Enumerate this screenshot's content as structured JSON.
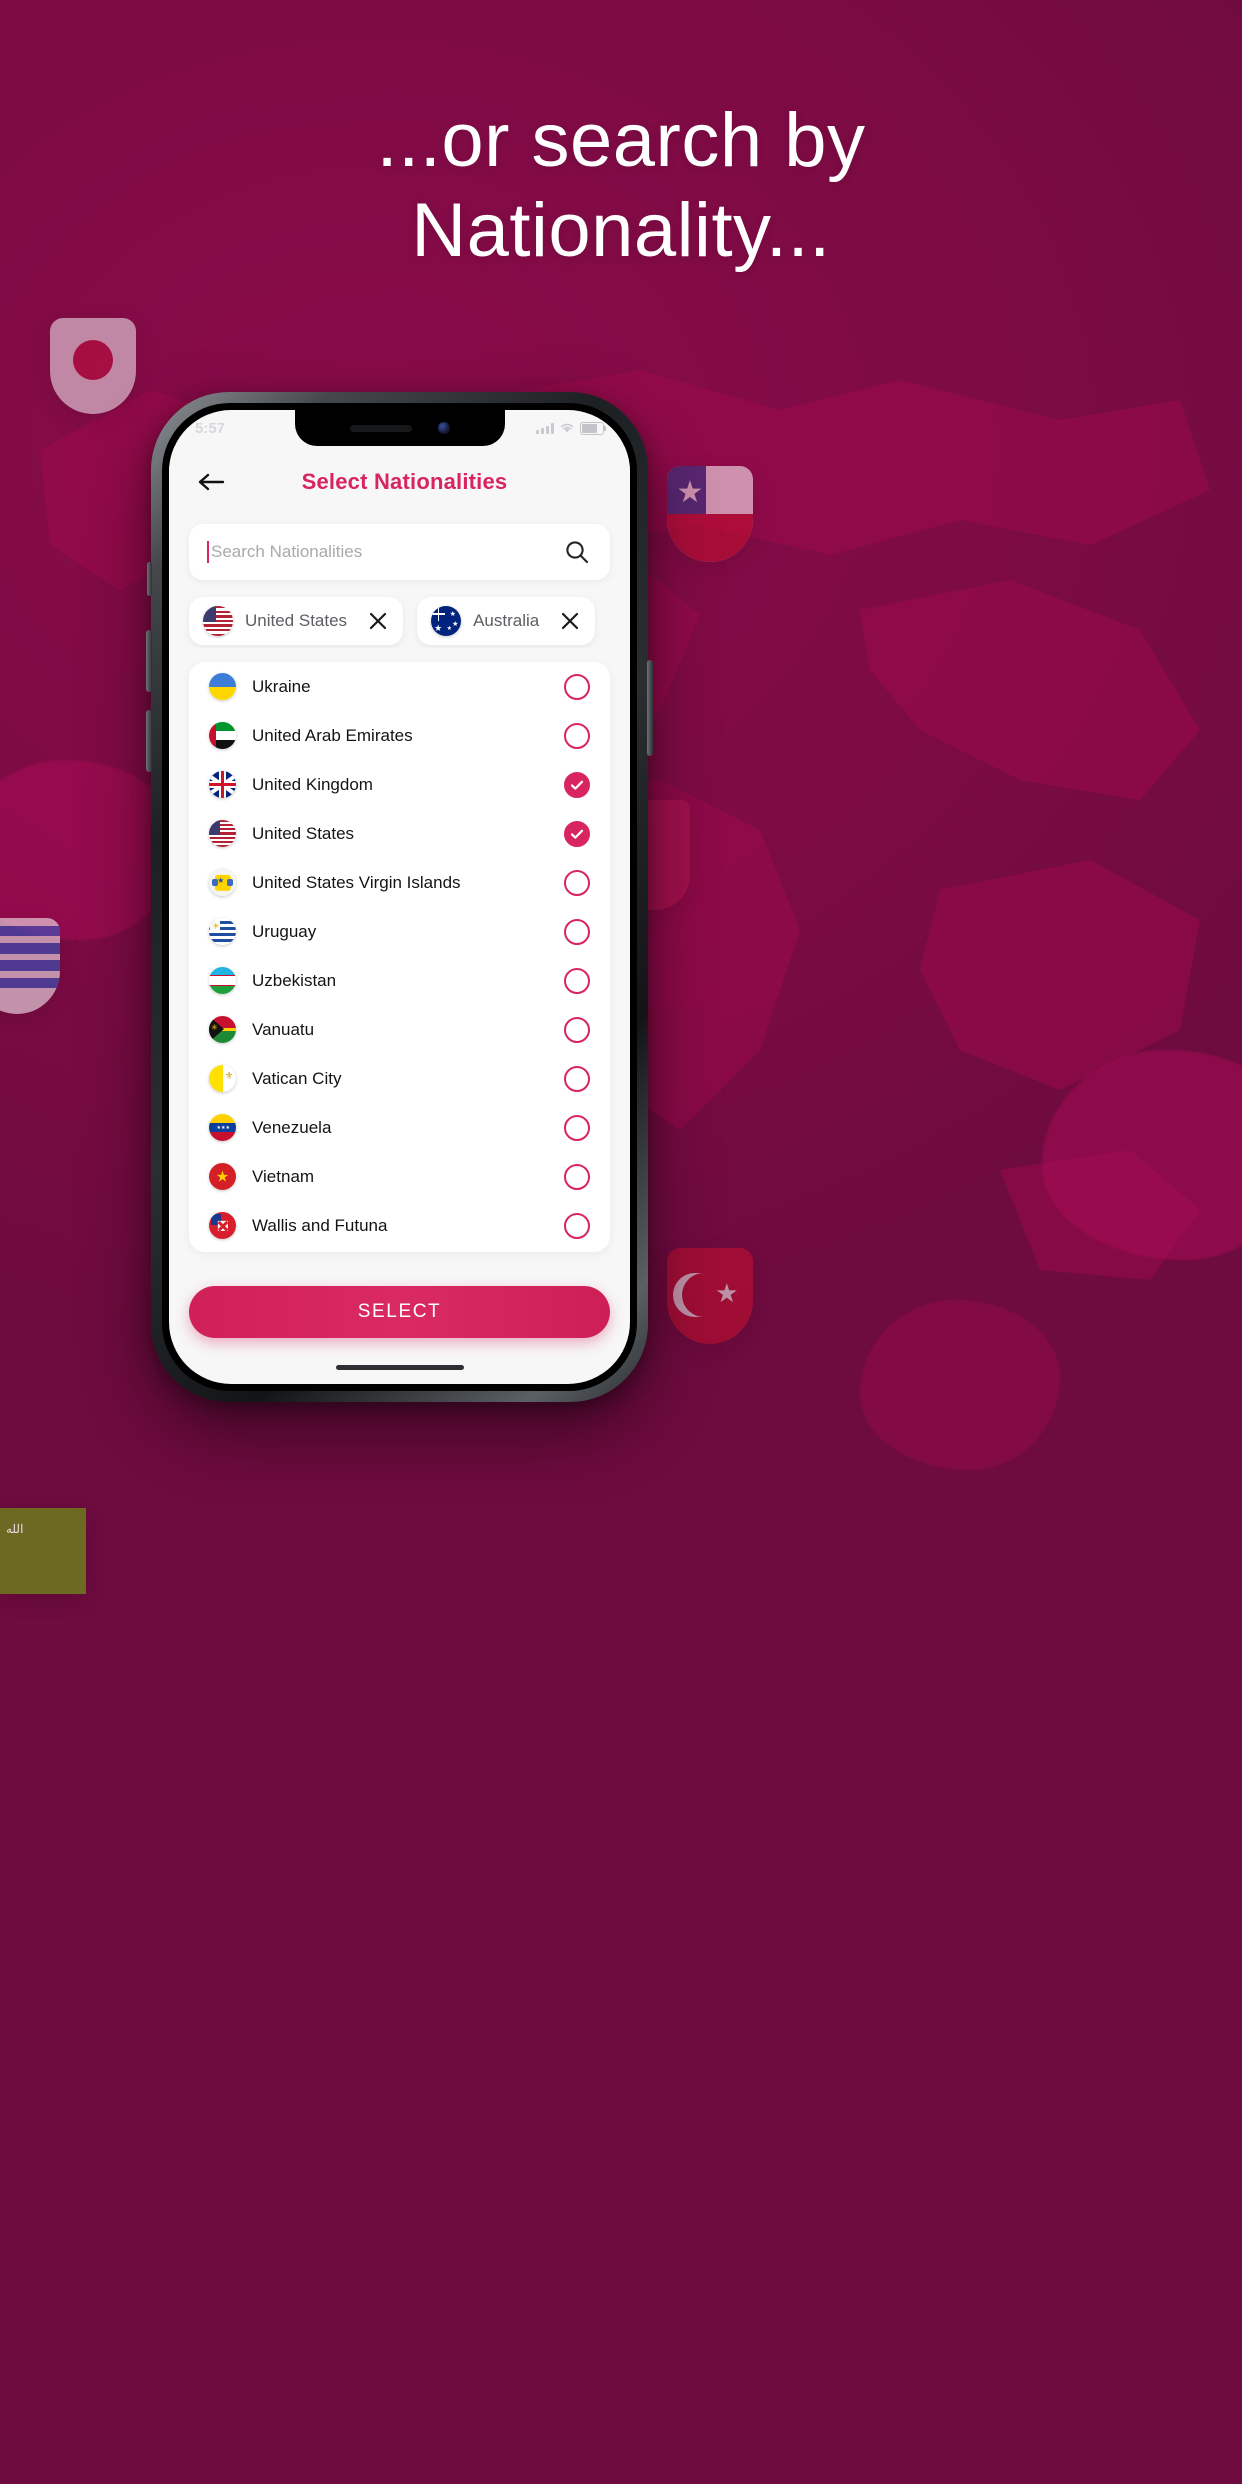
{
  "headline": {
    "line1": "...or search by",
    "line2": "Nationality..."
  },
  "colors": {
    "background": "#7d0b44",
    "accent": "#d8255f",
    "button_gradient_start": "#d02057",
    "button_gradient_end": "#cd1f55",
    "headline_text": "#ffffff",
    "list_text": "#141416",
    "chip_text": "#5d5d62",
    "placeholder_text": "#a9a9ae"
  },
  "status_bar": {
    "time": "5:57",
    "wifi_icon": "wifi-icon",
    "battery_icon": "battery-icon",
    "signal_icon": "signal-bars-icon"
  },
  "header": {
    "back_icon": "arrow-left-icon",
    "title": "Select Nationalities"
  },
  "search": {
    "placeholder": "Search Nationalities",
    "value": "",
    "icon": "search-icon"
  },
  "chips": [
    {
      "label": "United States",
      "flag": "us",
      "remove_icon": "close-icon"
    },
    {
      "label": "Australia",
      "flag": "au",
      "remove_icon": "close-icon"
    }
  ],
  "list": [
    {
      "label": "Ukraine",
      "flag": "ua",
      "checked": false
    },
    {
      "label": "United Arab Emirates",
      "flag": "ae",
      "checked": false
    },
    {
      "label": "United Kingdom",
      "flag": "gb",
      "checked": true
    },
    {
      "label": "United States",
      "flag": "us",
      "checked": true
    },
    {
      "label": "United States Virgin Islands",
      "flag": "vi",
      "checked": false
    },
    {
      "label": "Uruguay",
      "flag": "uy",
      "checked": false
    },
    {
      "label": "Uzbekistan",
      "flag": "uz",
      "checked": false
    },
    {
      "label": "Vanuatu",
      "flag": "vu",
      "checked": false
    },
    {
      "label": "Vatican City",
      "flag": "va",
      "checked": false
    },
    {
      "label": "Venezuela",
      "flag": "ve",
      "checked": false
    },
    {
      "label": "Vietnam",
      "flag": "vn",
      "checked": false
    },
    {
      "label": "Wallis and Futuna",
      "flag": "wf",
      "checked": false
    }
  ],
  "footer": {
    "select_label": "SELECT"
  },
  "background_flags": [
    {
      "country": "japan",
      "code": "jp"
    },
    {
      "country": "chile",
      "code": "cl"
    },
    {
      "country": "uruguay",
      "code": "uy"
    },
    {
      "country": "turkey",
      "code": "tr"
    },
    {
      "country": "saudi-arabia",
      "code": "sa"
    }
  ]
}
